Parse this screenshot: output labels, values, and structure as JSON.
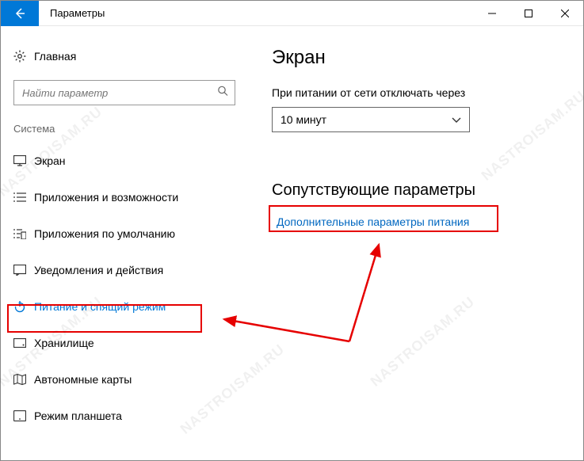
{
  "window": {
    "title": "Параметры"
  },
  "home": {
    "label": "Главная"
  },
  "search": {
    "placeholder": "Найти параметр"
  },
  "group": {
    "label": "Система"
  },
  "nav": {
    "items": [
      {
        "label": "Экран"
      },
      {
        "label": "Приложения и возможности"
      },
      {
        "label": "Приложения по умолчанию"
      },
      {
        "label": "Уведомления и действия"
      },
      {
        "label": "Питание и спящий режим"
      },
      {
        "label": "Хранилище"
      },
      {
        "label": "Автономные карты"
      },
      {
        "label": "Режим планшета"
      }
    ]
  },
  "main": {
    "heading": "Экран",
    "field_label": "При питании от сети отключать через",
    "dropdown_value": "10 минут",
    "related_heading": "Сопутствующие параметры",
    "link_text": "Дополнительные параметры питания"
  },
  "watermark": "NASTROISAM.RU"
}
